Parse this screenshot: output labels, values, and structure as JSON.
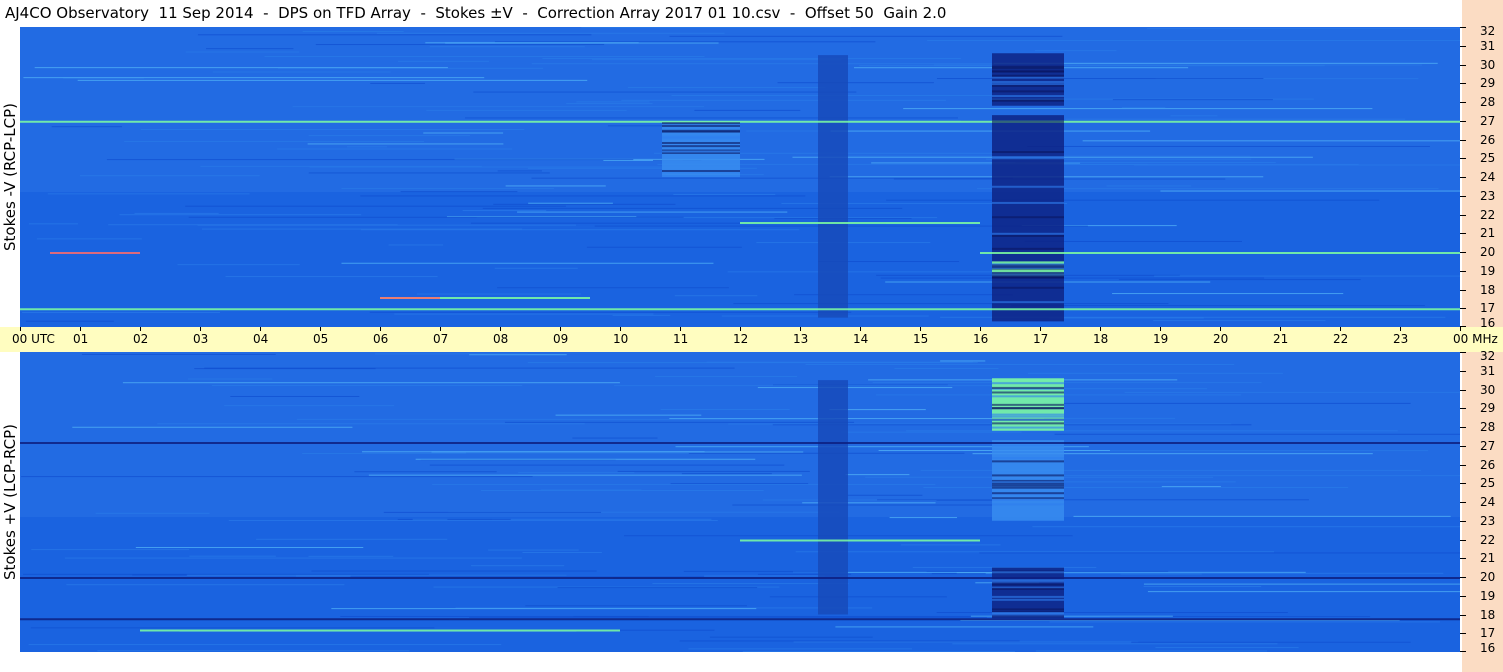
{
  "title": "AJ4CO Observatory  11 Sep 2014  -  DPS on TFD Array  -  Stokes ±V  -  Correction Array 2017 01 10.csv  -  Offset 50  Gain 2.0",
  "chart_data": [
    {
      "type": "heatmap",
      "ylabel": "Stokes -V (RCP-LCP)",
      "x_ticks": [
        "00 UTC",
        "01",
        "02",
        "03",
        "04",
        "05",
        "06",
        "07",
        "08",
        "09",
        "10",
        "11",
        "12",
        "13",
        "14",
        "15",
        "16",
        "17",
        "18",
        "19",
        "20",
        "21",
        "22",
        "23",
        "00"
      ],
      "y_ticks": [
        "32",
        "31",
        "30",
        "29",
        "28",
        "27",
        "26",
        "25",
        "24",
        "23",
        "22",
        "21",
        "20",
        "19",
        "18",
        "17",
        "16"
      ],
      "y_unit": "MHz",
      "xlim": [
        0,
        24
      ],
      "ylim": [
        16,
        32
      ],
      "colors": {
        "background": "#1a63e0",
        "deep": "#0a1a6e",
        "bright": "#7fffa0",
        "accent": "#ff6b6b"
      },
      "features": [
        {
          "kind": "band",
          "x": [
            16.2,
            17.4
          ],
          "y": [
            27.8,
            30.6
          ],
          "level": "dark"
        },
        {
          "kind": "band",
          "x": [
            16.2,
            17.4
          ],
          "y": [
            16.3,
            27.3
          ],
          "level": "dark"
        },
        {
          "kind": "band",
          "x": [
            16.2,
            17.4
          ],
          "y": [
            18.7,
            19.5
          ],
          "level": "bright"
        },
        {
          "kind": "band",
          "x": [
            13.3,
            13.8
          ],
          "y": [
            16.5,
            30.5
          ],
          "level": "mid-dark"
        },
        {
          "kind": "band",
          "x": [
            10.7,
            12.0
          ],
          "y": [
            24.0,
            27.0
          ],
          "level": "light"
        },
        {
          "kind": "streak",
          "x": [
            0.0,
            24.0
          ],
          "y": 27.0,
          "level": "bright"
        },
        {
          "kind": "streak",
          "x": [
            6.0,
            9.5
          ],
          "y": 17.6,
          "level": "bright"
        },
        {
          "kind": "streak",
          "x": [
            0.0,
            24.0
          ],
          "y": 17.0,
          "level": "bright"
        },
        {
          "kind": "streak",
          "x": [
            12.0,
            16.0
          ],
          "y": 21.6,
          "level": "bright"
        },
        {
          "kind": "streak",
          "x": [
            6.0,
            7.0
          ],
          "y": 17.6,
          "level": "accent"
        },
        {
          "kind": "streak",
          "x": [
            0.5,
            2.0
          ],
          "y": 20.0,
          "level": "accent"
        },
        {
          "kind": "streak",
          "x": [
            16.0,
            24.0
          ],
          "y": 20.0,
          "level": "bright"
        }
      ]
    },
    {
      "type": "heatmap",
      "ylabel": "Stokes +V (LCP-RCP)",
      "x_ticks": [
        "00 UTC",
        "01",
        "02",
        "03",
        "04",
        "05",
        "06",
        "07",
        "08",
        "09",
        "10",
        "11",
        "12",
        "13",
        "14",
        "15",
        "16",
        "17",
        "18",
        "19",
        "20",
        "21",
        "22",
        "23",
        "00"
      ],
      "y_ticks": [
        "32",
        "31",
        "30",
        "29",
        "28",
        "27",
        "26",
        "25",
        "24",
        "23",
        "22",
        "21",
        "20",
        "19",
        "18",
        "17",
        "16"
      ],
      "y_unit": "MHz",
      "xlim": [
        0,
        24
      ],
      "ylim": [
        16,
        32
      ],
      "colors": {
        "background": "#1a63e0",
        "deep": "#0a1a6e",
        "bright": "#7fffa0",
        "accent": "#ff6b6b"
      },
      "features": [
        {
          "kind": "band",
          "x": [
            16.2,
            17.4
          ],
          "y": [
            27.8,
            30.6
          ],
          "level": "bright"
        },
        {
          "kind": "band",
          "x": [
            16.2,
            17.4
          ],
          "y": [
            23.0,
            27.3
          ],
          "level": "light"
        },
        {
          "kind": "band",
          "x": [
            16.2,
            17.4
          ],
          "y": [
            17.8,
            20.5
          ],
          "level": "dark"
        },
        {
          "kind": "band",
          "x": [
            13.3,
            13.8
          ],
          "y": [
            18.0,
            30.5
          ],
          "level": "mid-dark"
        },
        {
          "kind": "streak",
          "x": [
            0.0,
            24.0
          ],
          "y": 27.2,
          "level": "dark"
        },
        {
          "kind": "streak",
          "x": [
            0.0,
            24.0
          ],
          "y": 17.8,
          "level": "dark"
        },
        {
          "kind": "streak",
          "x": [
            12.0,
            16.0
          ],
          "y": 22.0,
          "level": "bright"
        },
        {
          "kind": "streak",
          "x": [
            2.0,
            10.0
          ],
          "y": 17.2,
          "level": "bright"
        },
        {
          "kind": "streak",
          "x": [
            0.0,
            24.0
          ],
          "y": 20.0,
          "level": "dark"
        }
      ]
    }
  ],
  "right_strip_color": "#fbdcc3",
  "time_axis_color": "#fffdc0"
}
